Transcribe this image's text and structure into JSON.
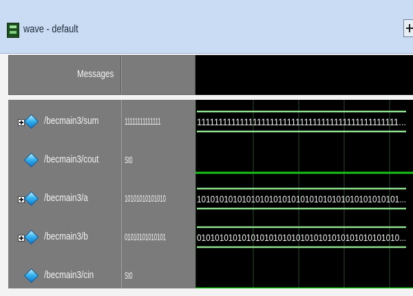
{
  "window": {
    "title": "wave - default",
    "app_icon": "modelsim-wave-icon",
    "dock_icon": "plus-dock-icon"
  },
  "header": {
    "messages_label": "Messages"
  },
  "signals": [
    {
      "name": "/becmain3/sum",
      "value": "11111111111111",
      "expandable": true,
      "wave_text": "11111111111111111111111111111111111111111111111..."
    },
    {
      "name": "/becmain3/cout",
      "value": "St0",
      "expandable": false,
      "wave_text": ""
    },
    {
      "name": "/becmain3/a",
      "value": "10101010101010",
      "expandable": true,
      "wave_text": "101010101010101010101010101010101010101010101..."
    },
    {
      "name": "/becmain3/b",
      "value": "01010101010101",
      "expandable": true,
      "wave_text": "010101010101010101010101010101010101010101010..."
    },
    {
      "name": "/becmain3/cin",
      "value": "St0",
      "expandable": false,
      "wave_text": ""
    }
  ],
  "colors": {
    "wave_bg": "#000000",
    "bus_line": "#8fe08f",
    "bit_line": "#19c219",
    "grid": "#2d4a2d",
    "text": "#f2f2f2",
    "panel": "#7b7b7b",
    "title_bar": "#c9dcf3"
  }
}
